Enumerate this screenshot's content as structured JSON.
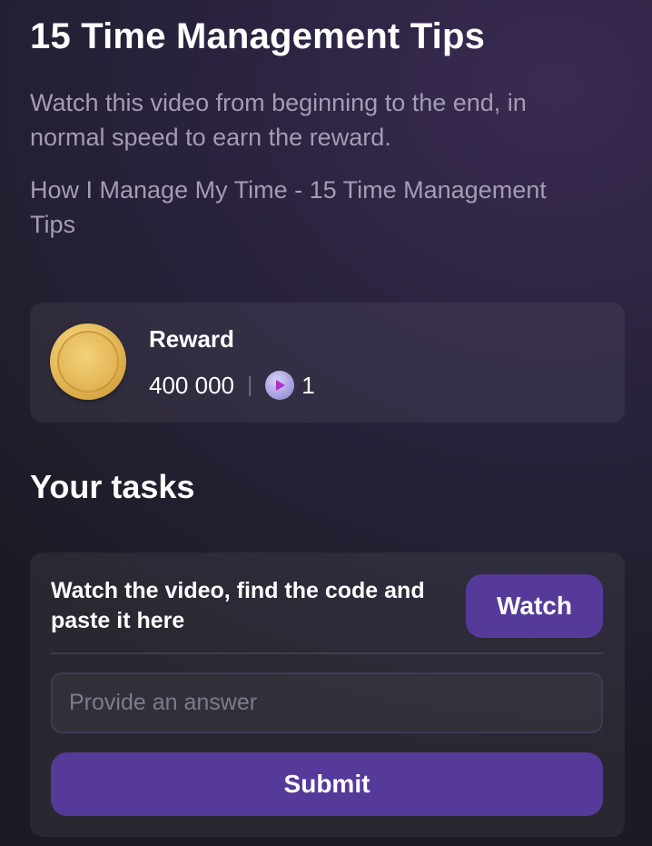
{
  "header": {
    "title": "15 Time Management Tips",
    "instructions": "Watch this video from beginning to the end, in normal speed to earn the reward.",
    "video_title": "How I Manage My Time - 15 Time Management Tips"
  },
  "reward": {
    "label": "Reward",
    "coins": "400 000",
    "separator": "|",
    "tickets": "1",
    "coin_icon": "gold-coin-icon",
    "ticket_icon": "play-token-icon"
  },
  "tasks": {
    "heading": "Your tasks",
    "items": [
      {
        "text": "Watch the video, find the code and paste it here",
        "watch_label": "Watch",
        "answer_placeholder": "Provide an answer",
        "answer_value": "",
        "submit_label": "Submit"
      }
    ]
  },
  "colors": {
    "accent": "#563a99",
    "muted_text": "#a59cb2",
    "card_bg": "rgba(255,255,255,0.06)"
  }
}
